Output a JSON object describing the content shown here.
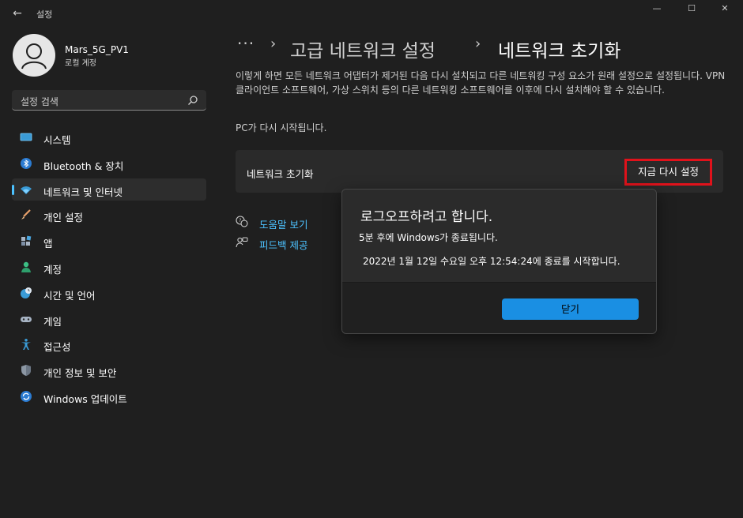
{
  "window": {
    "title": "설정",
    "back_glyph": "←",
    "controls": {
      "minimize": "—",
      "maximize": "☐",
      "close": "✕"
    }
  },
  "profile": {
    "name": "Mars_5G_PV1",
    "account_type": "로컬 계정"
  },
  "search": {
    "placeholder": "설정 검색"
  },
  "sidebar": {
    "selected_index": 2,
    "items": [
      {
        "label": "시스템",
        "icon": "monitor-icon"
      },
      {
        "label": "Bluetooth & 장치",
        "icon": "bluetooth-icon"
      },
      {
        "label": "네트워크 및 인터넷",
        "icon": "wifi-icon"
      },
      {
        "label": "개인 설정",
        "icon": "brush-icon"
      },
      {
        "label": "앱",
        "icon": "apps-icon"
      },
      {
        "label": "계정",
        "icon": "person-icon"
      },
      {
        "label": "시간 및 언어",
        "icon": "globe-clock-icon"
      },
      {
        "label": "게임",
        "icon": "gamepad-icon"
      },
      {
        "label": "접근성",
        "icon": "accessibility-icon"
      },
      {
        "label": "개인 정보 및 보안",
        "icon": "shield-icon"
      },
      {
        "label": "Windows 업데이트",
        "icon": "update-icon"
      }
    ]
  },
  "breadcrumb": {
    "overflow": "···",
    "separator": "›",
    "parent": "고급 네트워크 설정",
    "current": "네트워크 초기화"
  },
  "main": {
    "description": "이렇게 하면 모든 네트워크 어댑터가 제거된 다음 다시 설치되고 다른 네트워킹 구성 요소가 원래 설정으로 설정됩니다. VPN 클라이언트 소프트웨어, 가상 스위치 등의 다른 네트워킹 소프트웨어를 이후에 다시 설치해야 할 수 있습니다.",
    "restart_note": "PC가 다시 시작됩니다.",
    "card_label": "네트워크 초기화",
    "reset_button": "지금 다시 설정",
    "links": [
      {
        "label": "도움말 보기",
        "icon": "help-chat-icon"
      },
      {
        "label": "피드백 제공",
        "icon": "feedback-icon"
      }
    ]
  },
  "dialog": {
    "title": "로그오프하려고 합니다.",
    "message1": "5분 후에 Windows가 종료됩니다.",
    "message2": "2022년 1월 12일 수요일 오후 12:54:24에 종료를 시작합니다.",
    "close_button": "닫기"
  },
  "colors": {
    "accent": "#4cc2ff",
    "primary_button": "#1a8fe3",
    "highlight_border": "#e0121b"
  }
}
